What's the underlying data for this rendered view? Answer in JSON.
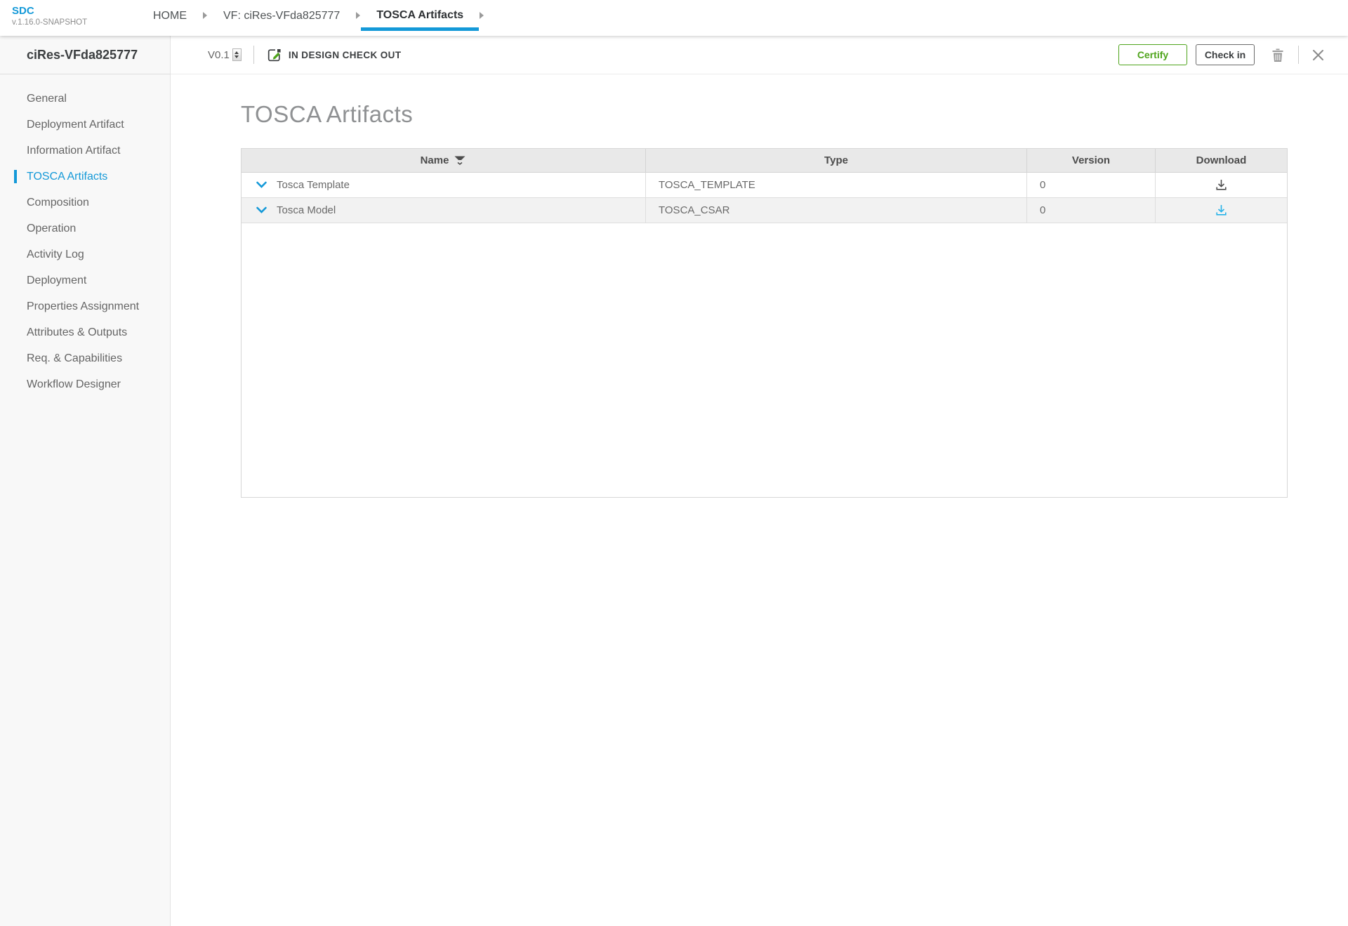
{
  "app": {
    "logo": "SDC",
    "build_version": "v.1.16.0-SNAPSHOT"
  },
  "breadcrumb": {
    "items": [
      {
        "label": "HOME",
        "active": false
      },
      {
        "label": "VF: ciRes-VFda825777",
        "active": false
      },
      {
        "label": "TOSCA Artifacts",
        "active": true
      }
    ]
  },
  "toolbar": {
    "version": "V0.1",
    "status_label": "IN DESIGN CHECK OUT",
    "certify_label": "Certify",
    "checkin_label": "Check in"
  },
  "sidebar": {
    "title": "ciRes-VFda825777",
    "items": [
      {
        "label": "General",
        "active": false
      },
      {
        "label": "Deployment Artifact",
        "active": false
      },
      {
        "label": "Information Artifact",
        "active": false
      },
      {
        "label": "TOSCA Artifacts",
        "active": true
      },
      {
        "label": "Composition",
        "active": false
      },
      {
        "label": "Operation",
        "active": false
      },
      {
        "label": "Activity Log",
        "active": false
      },
      {
        "label": "Deployment",
        "active": false
      },
      {
        "label": "Properties Assignment",
        "active": false
      },
      {
        "label": "Attributes & Outputs",
        "active": false
      },
      {
        "label": "Req. & Capabilities",
        "active": false
      },
      {
        "label": "Workflow Designer",
        "active": false
      }
    ]
  },
  "page": {
    "title": "TOSCA Artifacts"
  },
  "table": {
    "columns": [
      "Name",
      "Type",
      "Version",
      "Download"
    ],
    "rows": [
      {
        "name": "Tosca Template",
        "type": "TOSCA_TEMPLATE",
        "version": "0",
        "download_icon": "download-tray-dark"
      },
      {
        "name": "Tosca Model",
        "type": "TOSCA_CSAR",
        "version": "0",
        "download_icon": "download-tray-blue"
      }
    ]
  },
  "icons": {
    "breadcrumb_separator": "triangle-right",
    "version_stepper": "up-down-stepper",
    "status": "checkout-document-pencil",
    "delete": "trash",
    "close": "x",
    "name_sort": "sort-funnel-chevron",
    "row_expand": "chevron-down",
    "download": "download-tray"
  },
  "colors": {
    "accent_blue": "#1499d8",
    "certify_green": "#4fa41c",
    "download_blue": "#25b2e8",
    "table_header_bg": "#e9e9e9",
    "row_alt_bg": "#f2f2f2",
    "sidebar_bg": "#f8f8f8"
  }
}
